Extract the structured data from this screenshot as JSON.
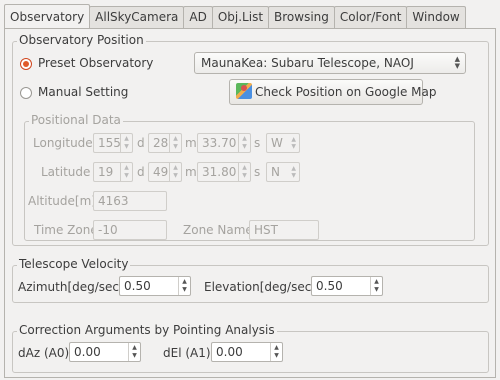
{
  "tabs": [
    {
      "label": "Observatory",
      "active": true
    },
    {
      "label": "AllSkyCamera",
      "active": false
    },
    {
      "label": "AD",
      "active": false
    },
    {
      "label": "Obj.List",
      "active": false
    },
    {
      "label": "Browsing",
      "active": false
    },
    {
      "label": "Color/Font",
      "active": false
    },
    {
      "label": "Window",
      "active": false
    }
  ],
  "observatory_position": {
    "title": "Observatory Position",
    "preset_label": "Preset Observatory",
    "manual_label": "Manual Setting",
    "preset_selected": true,
    "preset_value": "MaunaKea: Subaru Telescope, NAOJ",
    "google_button": "Check Position on Google Map",
    "positional": {
      "title": "Positional Data",
      "longitude_label": "Longitude",
      "latitude_label": "Latitude",
      "altitude_label": "Altitude[m]",
      "timezone_label": "Time Zone",
      "zonename_label": "Zone Name",
      "d": "d",
      "m": "m",
      "s": "s",
      "lon_deg": "155",
      "lon_min": "28",
      "lon_sec": "33.70",
      "lon_dir": "W",
      "lat_deg": "19",
      "lat_min": "49",
      "lat_sec": "31.80",
      "lat_dir": "N",
      "altitude": "4163",
      "timezone": "-10",
      "zonename": "HST"
    }
  },
  "velocity": {
    "title": "Telescope Velocity",
    "azimuth_label": "Azimuth[deg/sec]",
    "azimuth_value": "0.50",
    "elevation_label": "Elevation[deg/sec]",
    "elevation_value": "0.50"
  },
  "correction": {
    "title": "Correction Arguments by Pointing Analysis",
    "daz_label": "dAz (A0)",
    "daz_value": "0.00",
    "del_label": "dEl (A1)",
    "del_value": "0.00"
  },
  "colors": {
    "accent": "#e05a2a",
    "background": "#f2f1f0"
  }
}
